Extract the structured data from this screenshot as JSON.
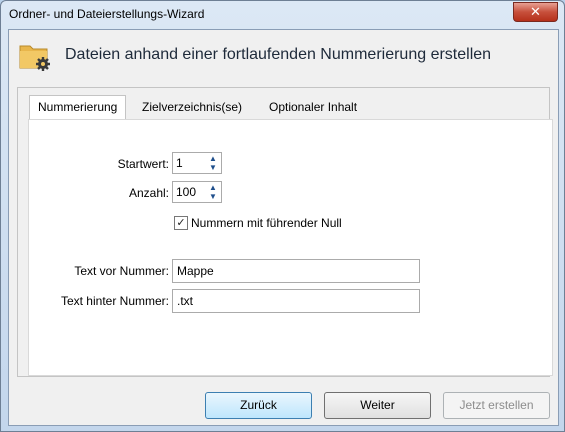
{
  "window": {
    "title": "Ordner- und Dateierstellungs-Wizard",
    "close_glyph": "✕"
  },
  "header": {
    "title": "Dateien anhand einer fortlaufenden Nummerierung erstellen",
    "icon": "folder-gear-icon"
  },
  "tabs": [
    {
      "label": "Nummerierung",
      "active": true
    },
    {
      "label": "Zielverzeichnis(se)",
      "active": false
    },
    {
      "label": "Optionaler Inhalt",
      "active": false
    }
  ],
  "form": {
    "startwert": {
      "label": "Startwert:",
      "value": "1"
    },
    "anzahl": {
      "label": "Anzahl:",
      "value": "100"
    },
    "leading_zero": {
      "label": "Nummern mit führender Null",
      "checked": true,
      "check_glyph": "✓"
    },
    "text_vor": {
      "label": "Text vor Nummer:",
      "value": "Mappe"
    },
    "text_hinter": {
      "label": "Text hinter Nummer:",
      "value": ".txt"
    }
  },
  "buttons": {
    "back": "Zurück",
    "next": "Weiter",
    "create": "Jetzt erstellen"
  }
}
